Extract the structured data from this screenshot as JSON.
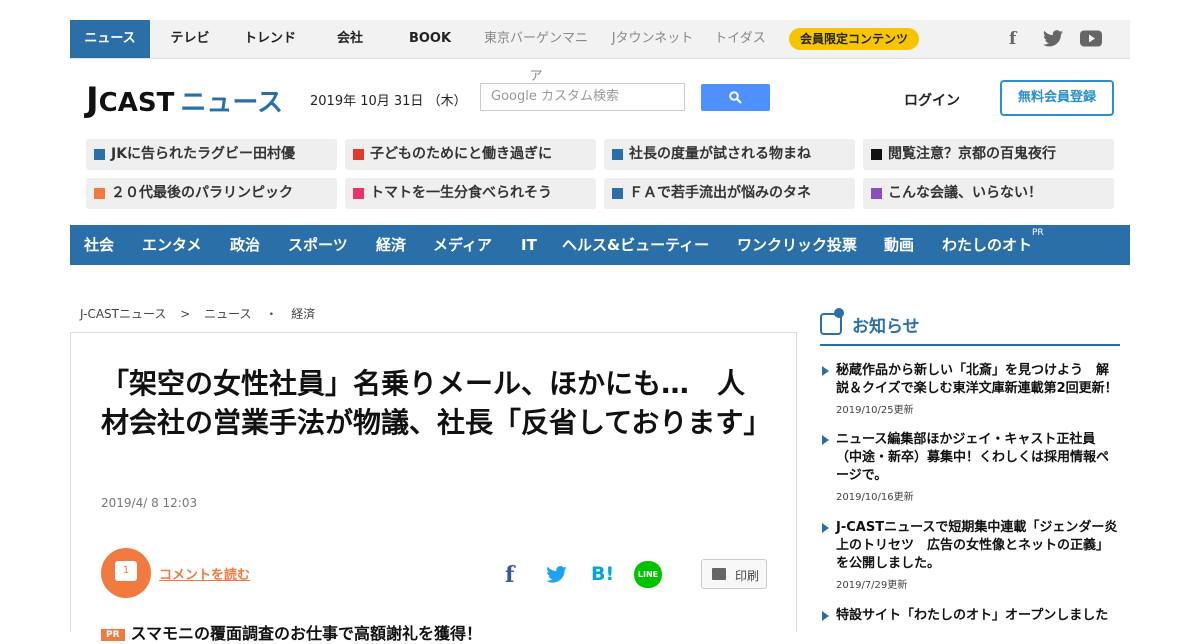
{
  "topbar": {
    "tabs": [
      "ニュース",
      "テレビ",
      "トレンド",
      "会社",
      "BOOK"
    ],
    "partner_links": [
      "東京バーゲンマニア",
      "Jタウンネット",
      "トイダス"
    ],
    "member_badge": "会員限定コンテンツ",
    "social": {
      "facebook": "f",
      "twitter": "twitter-icon",
      "youtube": "youtube-icon"
    }
  },
  "header": {
    "logo": {
      "j": "J",
      "cast": "CAST",
      "news": "ニュース"
    },
    "date": "2019年 10月 31日 （木）",
    "search_placeholder": "Google カスタム検索",
    "login": "ログイン",
    "register": "無料会員登録"
  },
  "trending": [
    {
      "label": "JKに告られたラグビー田村優",
      "color": "#2b6fa8"
    },
    {
      "label": "子どものためにと働き過ぎに",
      "color": "#e03a2f"
    },
    {
      "label": "社長の度量が試される物まね",
      "color": "#2b6fa8"
    },
    {
      "label": "閲覧注意？京都の百鬼夜行",
      "color": "#111111"
    },
    {
      "label": "２０代最後のパラリンピック",
      "color": "#f07a40"
    },
    {
      "label": "トマトを一生分食べられそう",
      "color": "#e8336b"
    },
    {
      "label": "ＦＡで若手流出が悩みのタネ",
      "color": "#2b6fa8"
    },
    {
      "label": "こんな会議、いらない！",
      "color": "#8a4fbf"
    }
  ],
  "categories": [
    "社会",
    "エンタメ",
    "政治",
    "スポーツ",
    "経済",
    "メディア",
    "IT",
    "ヘルス&ビューティー",
    "ワンクリック投票",
    "動画",
    "わたしのオト"
  ],
  "categories_pr": "PR",
  "breadcrumb": [
    "J-CASTニュース",
    ">",
    "ニュース",
    "・",
    "経済"
  ],
  "article": {
    "headline": "「架空の女性社員」名乗りメール、ほかにも…　人材会社の営業手法が物議、社長「反省しております」",
    "date": "2019/4/ 8 12:03",
    "comment_count": "1",
    "comment_link": "コメントを読む",
    "share": {
      "facebook": "f",
      "twitter": "twitter-icon",
      "hatena": "B!",
      "line": "LINE"
    },
    "print": "印刷",
    "pr_tag": "PR",
    "pr_text": "スマモニの覆面調査のお仕事で高額謝礼を獲得！"
  },
  "sidebar": {
    "title": "お知らせ",
    "items": [
      {
        "text": "秘蔵作品から新しい「北斎」を見つけよう　解説＆クイズで楽しむ東洋文庫新連載第2回更新！",
        "date": "2019/10/25更新"
      },
      {
        "text": "ニュース編集部ほかジェイ・キャスト正社員（中途・新卒）募集中！くわしくは採用情報ページで。",
        "date": "2019/10/16更新"
      },
      {
        "text": "J-CASTニュースで短期集中連載「ジェンダー炎上のトリセツ　広告の女性像とネットの正義」を公開しました。",
        "date": "2019/7/29更新"
      },
      {
        "text": "特設サイト「わたしのオト」オープンしました",
        "date": ""
      }
    ]
  }
}
